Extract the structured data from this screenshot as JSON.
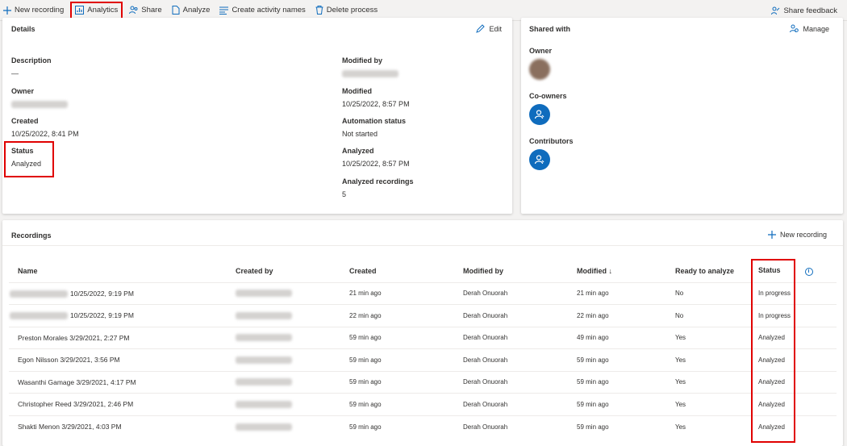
{
  "toolbar": {
    "new_recording": "New recording",
    "analytics": "Analytics",
    "share": "Share",
    "analyze": "Analyze",
    "create_activity_names": "Create activity names",
    "delete_process": "Delete process",
    "share_feedback": "Share feedback"
  },
  "details": {
    "title": "Details",
    "edit": "Edit",
    "description_label": "Description",
    "description_value": "—",
    "owner_label": "Owner",
    "created_label": "Created",
    "created_value": "10/25/2022, 8:41 PM",
    "status_label": "Status",
    "status_value": "Analyzed",
    "modified_by_label": "Modified by",
    "modified_label": "Modified",
    "modified_value": "10/25/2022, 8:57 PM",
    "automation_status_label": "Automation status",
    "automation_status_value": "Not started",
    "analyzed_label": "Analyzed",
    "analyzed_value": "10/25/2022, 8:57 PM",
    "analyzed_recordings_label": "Analyzed recordings",
    "analyzed_recordings_value": "5"
  },
  "shared": {
    "title": "Shared with",
    "manage": "Manage",
    "owner_label": "Owner",
    "coowners_label": "Co-owners",
    "contributors_label": "Contributors"
  },
  "recordings": {
    "title": "Recordings",
    "new_recording": "New recording",
    "columns": {
      "name": "Name",
      "created_by": "Created by",
      "created": "Created",
      "modified_by": "Modified by",
      "modified": "Modified ↓",
      "ready": "Ready to analyze",
      "status": "Status"
    },
    "rows": [
      {
        "name": "10/25/2022, 9:19 PM",
        "created": "21 min ago",
        "modified_by": "Derah Onuorah",
        "modified": "21 min ago",
        "ready": "No",
        "status": "In progress"
      },
      {
        "name": "10/25/2022, 9:19 PM",
        "created": "22 min ago",
        "modified_by": "Derah Onuorah",
        "modified": "22 min ago",
        "ready": "No",
        "status": "In progress"
      },
      {
        "name": "Preston Morales 3/29/2021, 2:27 PM",
        "created": "59 min ago",
        "modified_by": "Derah Onuorah",
        "modified": "49 min ago",
        "ready": "Yes",
        "status": "Analyzed"
      },
      {
        "name": "Egon Nilsson 3/29/2021, 3:56 PM",
        "created": "59 min ago",
        "modified_by": "Derah Onuorah",
        "modified": "59 min ago",
        "ready": "Yes",
        "status": "Analyzed"
      },
      {
        "name": "Wasanthi Gamage 3/29/2021, 4:17 PM",
        "created": "59 min ago",
        "modified_by": "Derah Onuorah",
        "modified": "59 min ago",
        "ready": "Yes",
        "status": "Analyzed"
      },
      {
        "name": "Christopher Reed 3/29/2021, 2:46 PM",
        "created": "59 min ago",
        "modified_by": "Derah Onuorah",
        "modified": "59 min ago",
        "ready": "Yes",
        "status": "Analyzed"
      },
      {
        "name": "Shakti Menon 3/29/2021, 4:03 PM",
        "created": "59 min ago",
        "modified_by": "Derah Onuorah",
        "modified": "59 min ago",
        "ready": "Yes",
        "status": "Analyzed"
      }
    ]
  },
  "colors": {
    "accent": "#0f6cbd",
    "highlight": "#e00000"
  }
}
